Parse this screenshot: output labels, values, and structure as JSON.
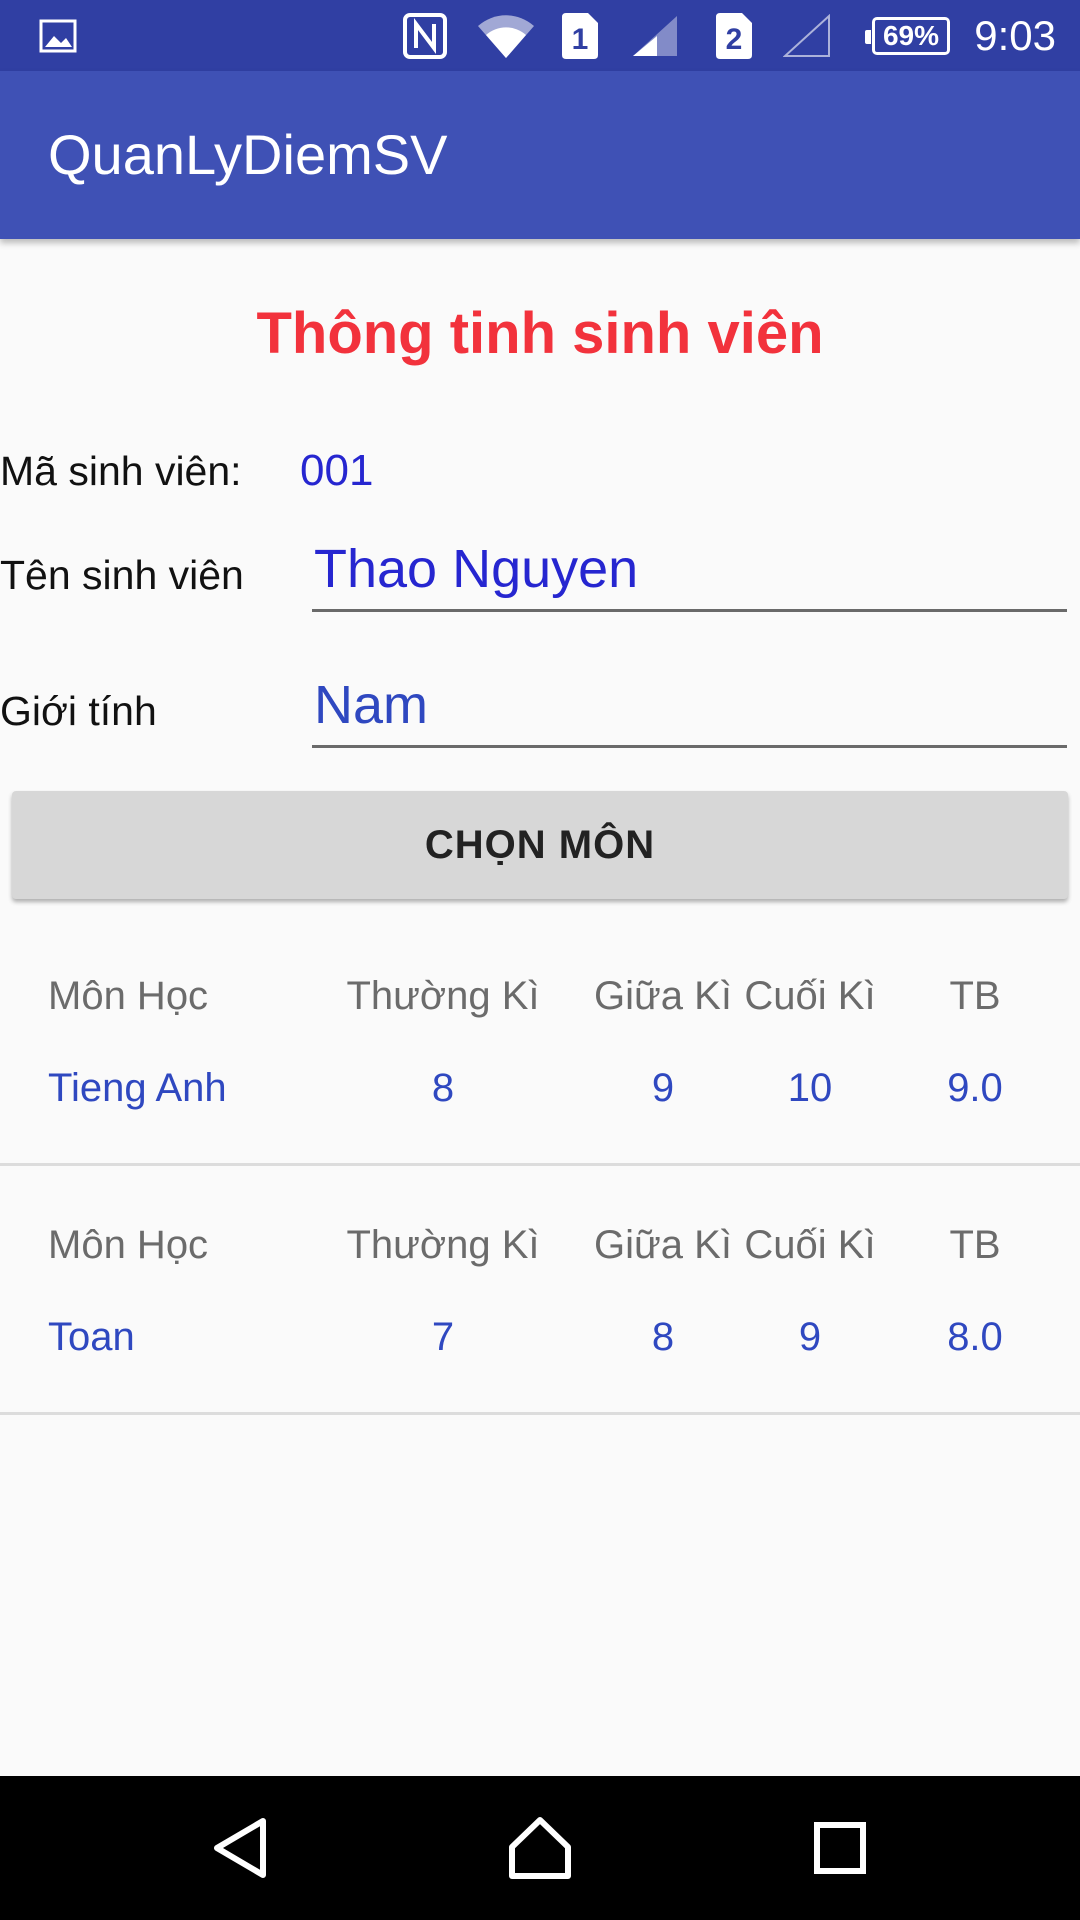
{
  "status_bar": {
    "time": "9:03",
    "battery": "69%",
    "sim1": "1",
    "sim2": "2",
    "icons": [
      "gallery-icon",
      "nfc-icon",
      "wifi-icon",
      "sim1-icon",
      "signal-icon",
      "sim2-icon",
      "no-signal-icon",
      "battery-icon"
    ]
  },
  "toolbar": {
    "title": "QuanLyDiemSV"
  },
  "form": {
    "heading": "Thông tinh sinh viên",
    "student_id_label": "Mã sinh viên:",
    "student_id_value": "001",
    "student_name_label": "Tên sinh viên",
    "student_name_value": "Thao Nguyen",
    "gender_label": "Giới tính",
    "gender_value": "Nam",
    "choose_subject_button": "CHỌN MÔN"
  },
  "grades": {
    "headers": [
      "Môn Học",
      "Thường Kì",
      "Giữa Kì",
      "Cuối Kì",
      "TB"
    ],
    "rows": [
      {
        "subject": "Tieng Anh",
        "regular": "8",
        "midterm": "9",
        "final": "10",
        "average": "9.0"
      },
      {
        "subject": "Toan",
        "regular": "7",
        "midterm": "8",
        "final": "9",
        "average": "8.0"
      }
    ]
  },
  "colors": {
    "status_bar": "#303fa3",
    "toolbar": "#3f51b5",
    "heading": "#f2323c",
    "value": "#2f48c0"
  },
  "nav_bar": {
    "icons": [
      "back-icon",
      "home-icon",
      "recents-icon"
    ]
  }
}
